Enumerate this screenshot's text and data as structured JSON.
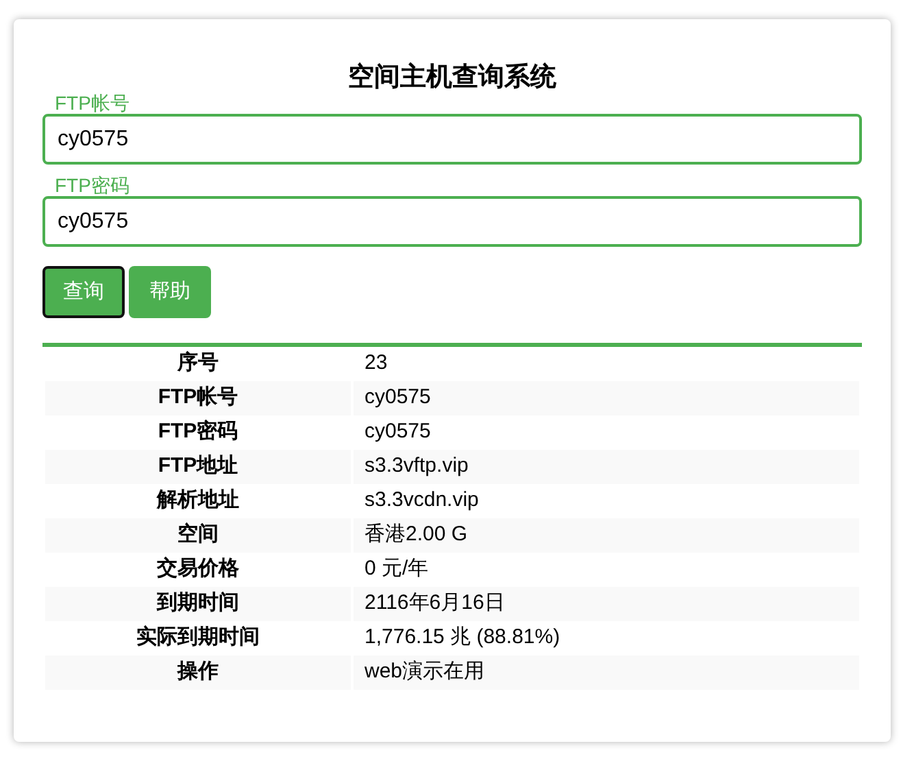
{
  "title": "空间主机查询系统",
  "fields": [
    {
      "label": "FTP帐号",
      "value": "cy0575"
    },
    {
      "label": "FTP密码",
      "value": "cy0575"
    }
  ],
  "buttons": [
    {
      "label": "查询",
      "focused": true
    },
    {
      "label": "帮助",
      "focused": false
    }
  ],
  "table": {
    "rows": [
      {
        "label": "序号",
        "value": "23"
      },
      {
        "label": "FTP帐号",
        "value": "cy0575"
      },
      {
        "label": "FTP密码",
        "value": "cy0575"
      },
      {
        "label": "FTP地址",
        "value": "s3.3vftp.vip"
      },
      {
        "label": "解析地址",
        "value": "s3.3vcdn.vip"
      },
      {
        "label": "空间",
        "value": "香港2.00 G"
      },
      {
        "label": "交易价格",
        "value": "0 元/年"
      },
      {
        "label": "到期时间",
        "value": "2116年6月16日"
      },
      {
        "label": "实际到期时间",
        "value": "1,776.15 兆 (88.81%)"
      },
      {
        "label": "操作",
        "value": "web演示在用"
      }
    ]
  }
}
